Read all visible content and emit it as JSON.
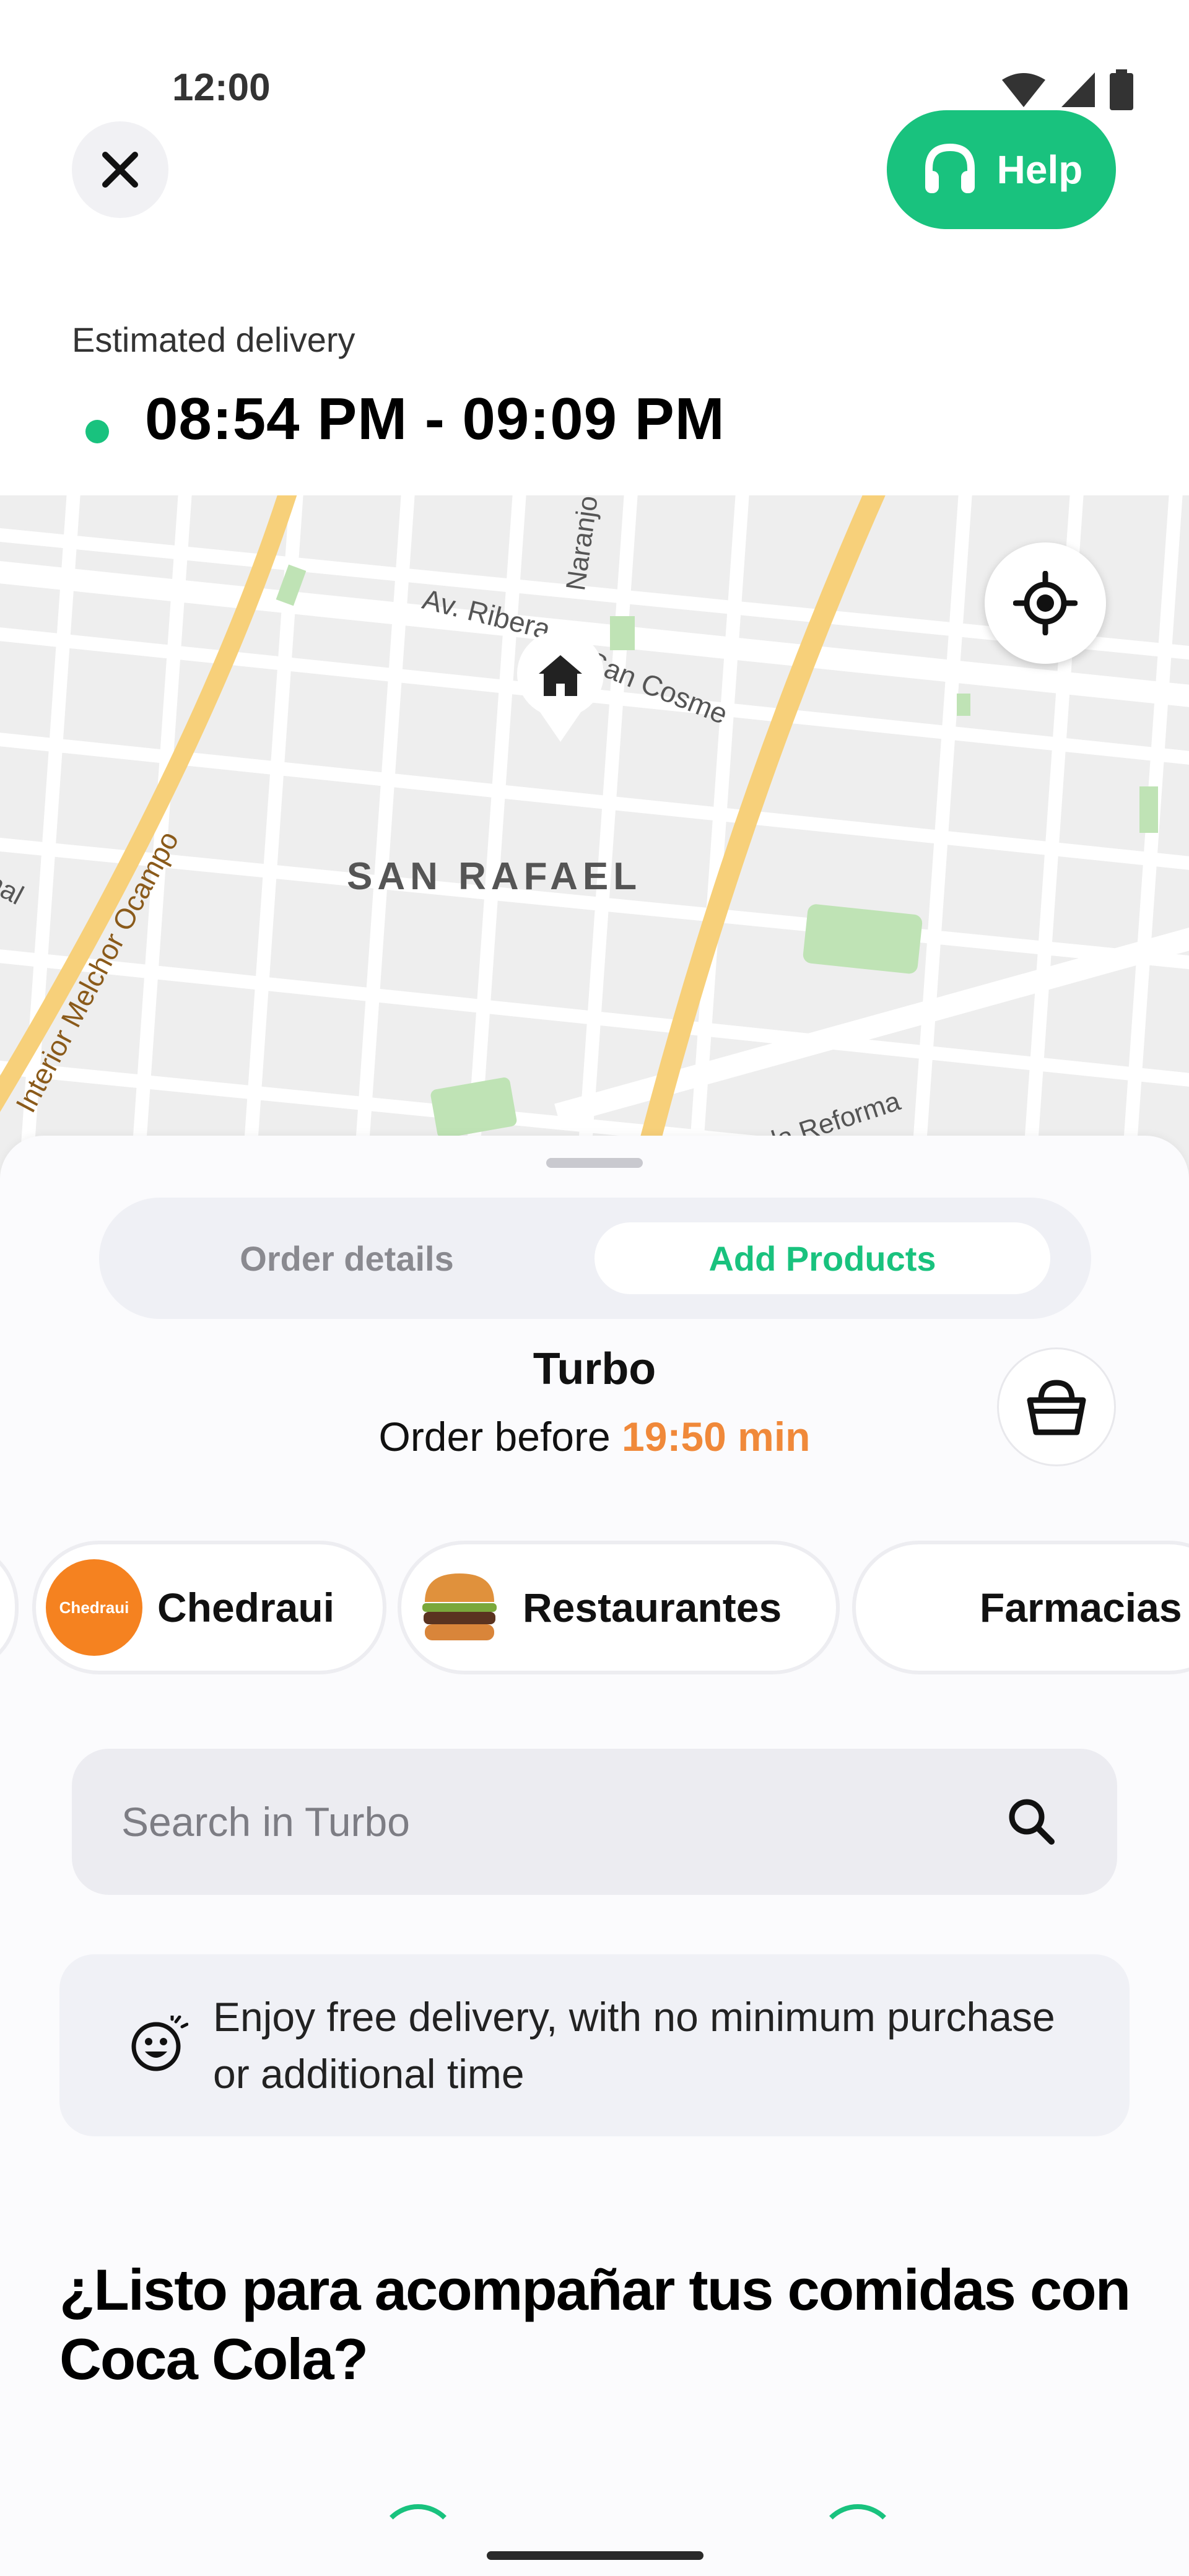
{
  "status_bar": {
    "time": "12:00"
  },
  "header": {
    "help_label": "Help"
  },
  "delivery": {
    "label": "Estimated delivery",
    "window": "08:54 PM - 09:09 PM"
  },
  "map": {
    "labels": {
      "neighborhood": "SAN RAFAEL",
      "street_1": "Av. Ribera",
      "street_2": "San Cosme",
      "street_3": "Naranjo",
      "street_4": "Interior Melchor Ocampo",
      "street_5": "la Reforma",
      "street_6": "nal"
    }
  },
  "tabs": [
    {
      "label": "Order details",
      "active": false
    },
    {
      "label": "Add Products",
      "active": true
    }
  ],
  "store": {
    "name": "Turbo",
    "order_before_prefix": "Order before ",
    "timer": "19:50 min"
  },
  "categories": [
    {
      "label": "Chedraui",
      "logo_text": "Chedraui"
    },
    {
      "label": "Restaurantes"
    },
    {
      "label": "Farmacias"
    }
  ],
  "search": {
    "placeholder": "Search in Turbo"
  },
  "promo": {
    "text": "Enjoy free delivery, with no minimum purchase or additional time"
  },
  "section": {
    "headline": "¿Listo para acompañar tus comidas con Coca Cola?"
  },
  "colors": {
    "accent": "#19c27e",
    "timer": "#f0893a",
    "road_major": "#f7d07a"
  }
}
